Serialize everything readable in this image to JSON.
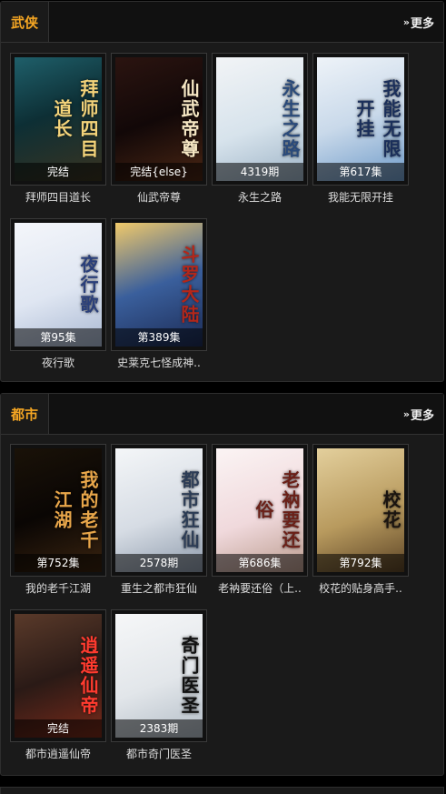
{
  "sections": [
    {
      "title": "武侠",
      "more_label": "更多",
      "items": [
        {
          "name": "拜师四目道长",
          "badge": "完结",
          "cover_text": "拜师四目道长",
          "bg": "linear-gradient(160deg,#1f5f6a 0%,#0d2f35 45%,#3a3320 100%)",
          "fg": "#f3d37a"
        },
        {
          "name": "仙武帝尊",
          "badge": "完结{else}",
          "cover_text": "仙武帝尊",
          "bg": "linear-gradient(160deg,#2b1410 0%,#120808 50%,#4a2614 100%)",
          "fg": "#f6e7c4"
        },
        {
          "name": "永生之路",
          "badge": "4319期",
          "cover_text": "永生之路",
          "bg": "linear-gradient(160deg,#f2f4f6 0%,#d7e3ec 55%,#9db3c6 100%)",
          "fg": "#2a4a7a"
        },
        {
          "name": "我能无限开挂",
          "badge": "第617集",
          "cover_text": "我能无限开挂",
          "bg": "linear-gradient(160deg,#eef3f8 0%,#c9d9ea 50%,#6f9bc9 100%)",
          "fg": "#1b2f5a"
        }
      ]
    },
    {
      "title": "",
      "more_label": "",
      "items": [
        {
          "name": "夜行歌",
          "badge": "第95集",
          "cover_text": "夜行歌",
          "bg": "linear-gradient(160deg,#f4f6fa 0%,#dfe6f2 55%,#a9b8d2 100%)",
          "fg": "#2a3f7a"
        },
        {
          "name": "史莱克七怪成神..",
          "badge": "第389集",
          "cover_text": "斗罗大陆",
          "bg": "linear-gradient(160deg,#f0c96a 0%,#3a5f9c 50%,#1c2b55 100%)",
          "fg": "#b3271a"
        }
      ]
    },
    {
      "title": "都市",
      "more_label": "更多",
      "items": [
        {
          "name": "我的老千江湖",
          "badge": "第752集",
          "cover_text": "我的老千江湖",
          "bg": "linear-gradient(160deg,#1a1208 0%,#0a0604 50%,#3a2410 100%)",
          "fg": "#e8a64a"
        },
        {
          "name": "重生之都市狂仙",
          "badge": "2578期",
          "cover_text": "都市狂仙",
          "bg": "linear-gradient(160deg,#f4f6f8 0%,#d6dce4 55%,#8d9aab 100%)",
          "fg": "#2c3c55"
        },
        {
          "name": "老衲要还俗（上..",
          "badge": "第686集",
          "cover_text": "老衲要还俗",
          "bg": "linear-gradient(160deg,#fbf4f4 0%,#f0d9dc 55%,#b99a8c 100%)",
          "fg": "#6a2018"
        },
        {
          "name": "校花的贴身高手..",
          "badge": "第792集",
          "cover_text": "校花",
          "bg": "linear-gradient(160deg,#e3cf9c 0%,#b89a5e 55%,#5c4426 100%)",
          "fg": "#1a1410"
        }
      ]
    },
    {
      "title": "",
      "more_label": "",
      "items": [
        {
          "name": "都市逍遥仙帝",
          "badge": "完结",
          "cover_text": "逍遥仙帝",
          "bg": "linear-gradient(160deg,#5a3a2a 0%,#2a1a16 50%,#7a2a1a 100%)",
          "fg": "#ff3b2f"
        },
        {
          "name": "都市奇门医圣",
          "badge": "2383期",
          "cover_text": "奇门医圣",
          "bg": "linear-gradient(160deg,#f6f7f8 0%,#e2e6ea 55%,#b2bcc6 100%)",
          "fg": "#111"
        }
      ]
    }
  ]
}
